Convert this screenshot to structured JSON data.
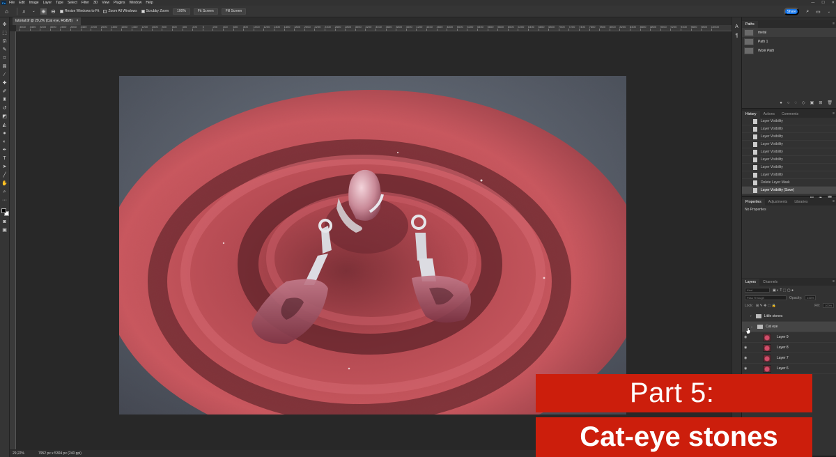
{
  "menu": [
    "File",
    "Edit",
    "Image",
    "Layer",
    "Type",
    "Select",
    "Filter",
    "3D",
    "View",
    "Plugins",
    "Window",
    "Help"
  ],
  "app_logo": "Ps",
  "options_bar": {
    "resize_windows": "Resize Windows to Fit",
    "zoom_all": "Zoom All Windows",
    "scrubby_zoom": "Scrubby Zoom",
    "zoom_100": "100%",
    "fit_screen": "Fit Screen",
    "fill_screen": "Fill Screen",
    "share": "Share"
  },
  "document": {
    "tab_title": "tutorial.tif @ 29,2% (Cat eye, RGB/8)",
    "ruler_ticks": [
      "3600",
      "3400",
      "3200",
      "3000",
      "2800",
      "2600",
      "2400",
      "2200",
      "2000",
      "1800",
      "1600",
      "1400",
      "1200",
      "1000",
      "800",
      "600",
      "400",
      "200",
      "0",
      "200",
      "400",
      "600",
      "800",
      "1000",
      "1200",
      "1400",
      "1600",
      "1800",
      "2000",
      "2200",
      "2400",
      "2600",
      "2800",
      "3000",
      "3200",
      "3400",
      "3600",
      "3800",
      "4000",
      "4200",
      "4400",
      "4600",
      "4800",
      "5000",
      "5200",
      "5400",
      "5600",
      "5800",
      "6000",
      "6200",
      "6400",
      "6600",
      "6800",
      "7000",
      "7200",
      "7400",
      "7600",
      "7800",
      "8000",
      "8200",
      "8400",
      "8600",
      "8800",
      "9000",
      "9200",
      "9400",
      "9600",
      "9800",
      "10000"
    ]
  },
  "status": {
    "zoom": "29,22%",
    "dimensions": "7952 px x 5304 px (240 ppi)"
  },
  "paths_panel": {
    "tab": "Paths",
    "items": [
      "metal",
      "Path 1",
      "Work Path"
    ]
  },
  "history_panel": {
    "tabs": [
      "History",
      "Actions",
      "Comments"
    ],
    "items": [
      "Layer Visibility",
      "Layer Visibility",
      "Layer Visibility",
      "Layer Visibility",
      "Layer Visibility",
      "Layer Visibility",
      "Layer Visibility",
      "Layer Visibility",
      "Delete Layer Mask",
      "Layer Visibility (Save)"
    ]
  },
  "properties_panel": {
    "tabs": [
      "Properties",
      "Adjustments",
      "Libraries"
    ],
    "text": "No Properties"
  },
  "layers_panel": {
    "tabs": [
      "Layers",
      "Channels"
    ],
    "kind": "Kind",
    "blend": "Pass Through",
    "opacity_label": "Opacity:",
    "opacity_value": "100%",
    "lock_label": "Lock:",
    "fill_label": "Fill:",
    "fill_value": "100%",
    "items": [
      {
        "name": "Little stones",
        "type": "group"
      },
      {
        "name": "Cat eye",
        "type": "group"
      },
      {
        "name": "Layer 9",
        "type": "layer"
      },
      {
        "name": "Layer 8",
        "type": "layer"
      },
      {
        "name": "Layer 7",
        "type": "layer"
      },
      {
        "name": "Layer 6",
        "type": "layer"
      }
    ]
  },
  "overlay": {
    "line1": "Part 5:",
    "line2": "Cat-eye stones"
  },
  "colors": {
    "accent": "#cc1e0c",
    "share": "#1473e6",
    "sand": "#c2545c"
  }
}
